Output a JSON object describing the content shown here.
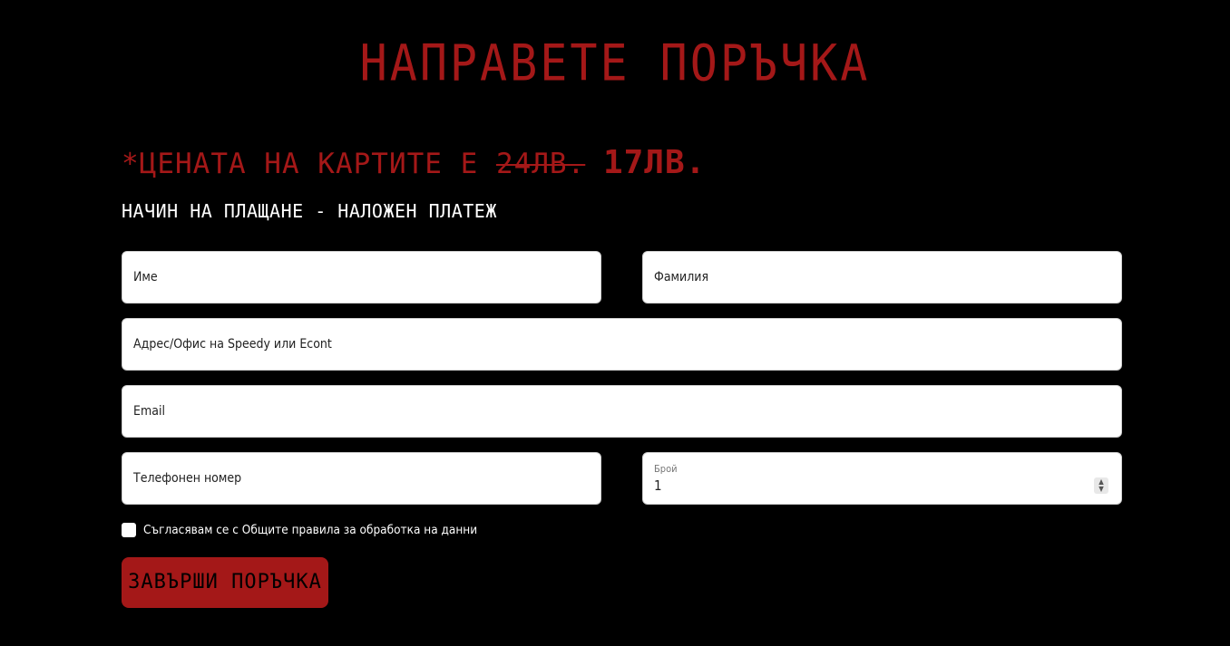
{
  "colors": {
    "background": "#000000",
    "accent": "#a41818",
    "field_background": "#ffffff"
  },
  "page": {
    "title": "НАПРАВЕТЕ ПОРЪЧКА"
  },
  "pricing": {
    "prefix": "*ЦЕНАТА НА КАРТИТЕ Е ",
    "old_price": "24ЛВ.",
    "new_price": "17ЛВ."
  },
  "payment": {
    "text": "НАЧИН НА ПЛАЩАНЕ - НАЛОЖЕН ПЛАТЕЖ"
  },
  "form": {
    "first_name_placeholder": "Име",
    "last_name_placeholder": "Фамилия",
    "address_placeholder": "Адрес/Офис на Speedy или Econt",
    "email_placeholder": "Email",
    "phone_placeholder": "Телефонен номер",
    "quantity_label": "Брой",
    "quantity_value": "1",
    "consent_text": "Съгласявам се с Общите правила за обработка на данни",
    "submit_label": "ЗАВЪРШИ ПОРЪЧКА"
  }
}
